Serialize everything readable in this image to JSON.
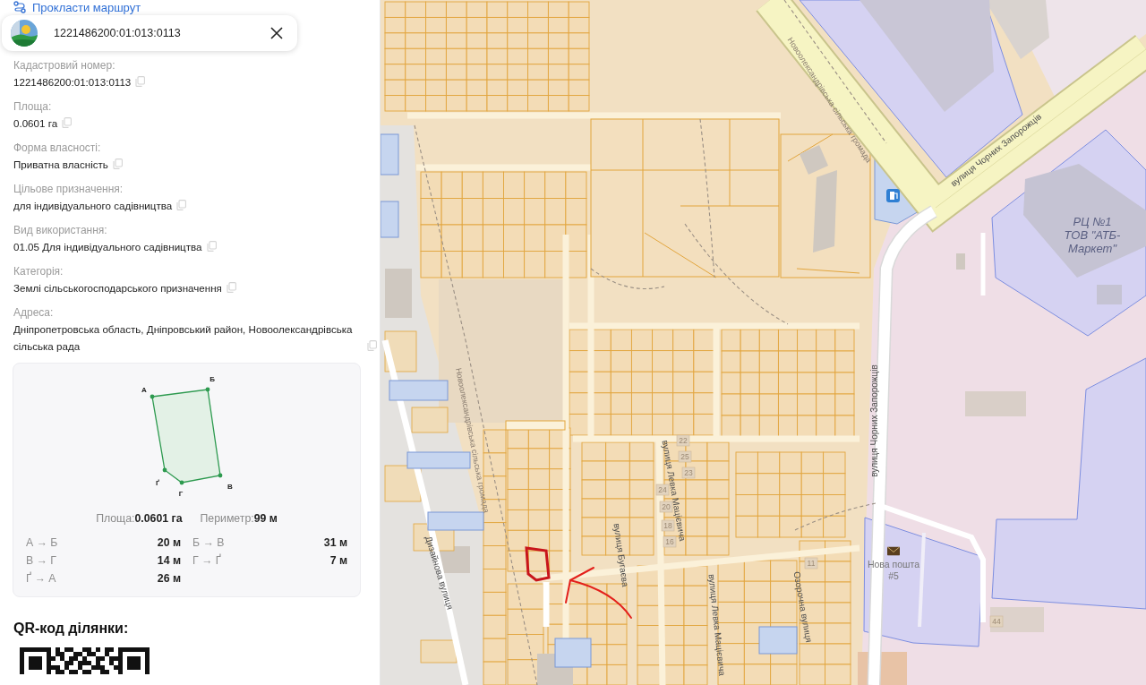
{
  "route_link": {
    "label": "Прокласти маршрут"
  },
  "header": {
    "title": "1221486200:01:013:0113"
  },
  "fields": [
    {
      "label": "Кадастровий номер:",
      "value": "1221486200:01:013:0113"
    },
    {
      "label": "Площа:",
      "value": "0.0601 га"
    },
    {
      "label": "Форма власності:",
      "value": "Приватна власність"
    },
    {
      "label": "Цільове призначення:",
      "value": "для індивідуального садівництва"
    },
    {
      "label": "Вид використання:",
      "value": "01.05 Для індивідуального садівництва"
    },
    {
      "label": "Категорія:",
      "value": "Землі сільськогосподарського призначення"
    },
    {
      "label": "Адреса:",
      "value": "Дніпропетровська область, Дніпровський район, Новоолександрівська сільська рада"
    }
  ],
  "parcel_card": {
    "vertices": [
      "А",
      "Б",
      "В",
      "Г",
      "Ґ"
    ],
    "summary": [
      {
        "label": "Площа:",
        "value": "0.0601 га"
      },
      {
        "label": "Периметр:",
        "value": "99 м"
      }
    ],
    "segments": [
      {
        "label": "А → Б",
        "length": "20 м"
      },
      {
        "label": "Б → В",
        "length": "31 м"
      },
      {
        "label": "В → Г",
        "length": "14 м"
      },
      {
        "label": "Г → Ґ",
        "length": "7 м"
      },
      {
        "label": "Ґ → А",
        "length": "26 м"
      }
    ]
  },
  "qr": {
    "title": "QR-код ділянки:"
  },
  "map": {
    "street_labels": [
      "вулиця Чорних Запорожців",
      "вулиця Чорних Запорожців",
      "вулиця Бугаєва",
      "вулиця Левка Мацієвича",
      "вулиця Левка Мацієвича",
      "Озорочна вулиця",
      "Дизайнова вулиця"
    ],
    "boundary_labels": [
      "Новоолександрівська сільська громада",
      "Новоолександрівська сільська громада"
    ],
    "places": [
      {
        "kind": "company",
        "name": "РЦ №1 ТОВ \"АТБ-Маркет\""
      },
      {
        "kind": "post",
        "name": "Нова пошта #5"
      }
    ],
    "house_numbers": [
      "22",
      "25",
      "23",
      "24",
      "20",
      "18",
      "16",
      "11",
      "44"
    ]
  }
}
